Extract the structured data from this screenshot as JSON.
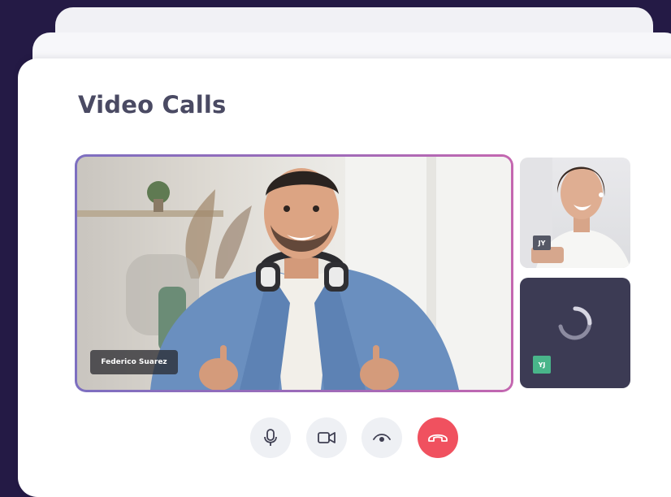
{
  "page": {
    "title": "Video Calls"
  },
  "main_video": {
    "participant_name": "Federico Suarez"
  },
  "side_tiles": [
    {
      "initials": "JY",
      "state": "video"
    },
    {
      "initials": "YJ",
      "state": "loading"
    }
  ],
  "controls": {
    "mic_icon": "microphone-icon",
    "camera_icon": "video-camera-icon",
    "view_icon": "eye-icon",
    "end_icon": "hang-up-icon"
  },
  "colors": {
    "background": "#241a45",
    "card": "#ffffff",
    "title": "#4a4a63",
    "highlight_border_start": "#7d6fc0",
    "highlight_border_end": "#c467b0",
    "end_call": "#f0515f",
    "control_button": "#eef0f4",
    "loading_tile": "#3c3b54",
    "initials_badge": "#49b58a"
  }
}
